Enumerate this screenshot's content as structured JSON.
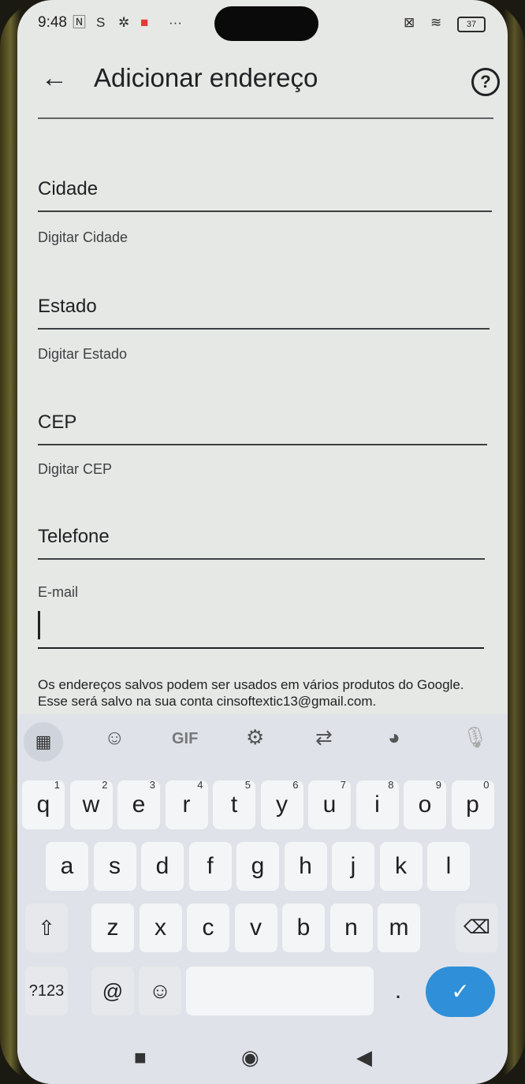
{
  "status_bar": {
    "time": "9:48",
    "left_icons": [
      "nfc-icon",
      "s-icon",
      "gear-icon",
      "notification-icon",
      "more-dots-icon"
    ],
    "battery": "37"
  },
  "app_bar": {
    "title": "Adicionar endereço"
  },
  "form": {
    "cidade": {
      "label": "Cidade",
      "hint": "Digitar Cidade"
    },
    "estado": {
      "label": "Estado",
      "hint": "Digitar Estado"
    },
    "cep": {
      "label": "CEP",
      "hint": "Digitar CEP"
    },
    "telefone": {
      "label": "Telefone"
    },
    "email": {
      "label": "E-mail",
      "value": ""
    },
    "notice": "Os endereços salvos podem ser usados em vários produtos do Google. Esse será salvo na sua conta cinsoftextic13@gmail.com."
  },
  "keyboard": {
    "toolbar": {
      "gif_label": "GIF"
    },
    "row1": [
      {
        "k": "q",
        "n": "1"
      },
      {
        "k": "w",
        "n": "2"
      },
      {
        "k": "e",
        "n": "3"
      },
      {
        "k": "r",
        "n": "4"
      },
      {
        "k": "t",
        "n": "5"
      },
      {
        "k": "y",
        "n": "6"
      },
      {
        "k": "u",
        "n": "7"
      },
      {
        "k": "i",
        "n": "8"
      },
      {
        "k": "o",
        "n": "9"
      },
      {
        "k": "p",
        "n": "0"
      }
    ],
    "row2": [
      "a",
      "s",
      "d",
      "f",
      "g",
      "h",
      "j",
      "k",
      "l"
    ],
    "row3": [
      "z",
      "x",
      "c",
      "v",
      "b",
      "n",
      "m"
    ],
    "symbols_label": "?123",
    "at_label": "@",
    "period_label": "."
  }
}
